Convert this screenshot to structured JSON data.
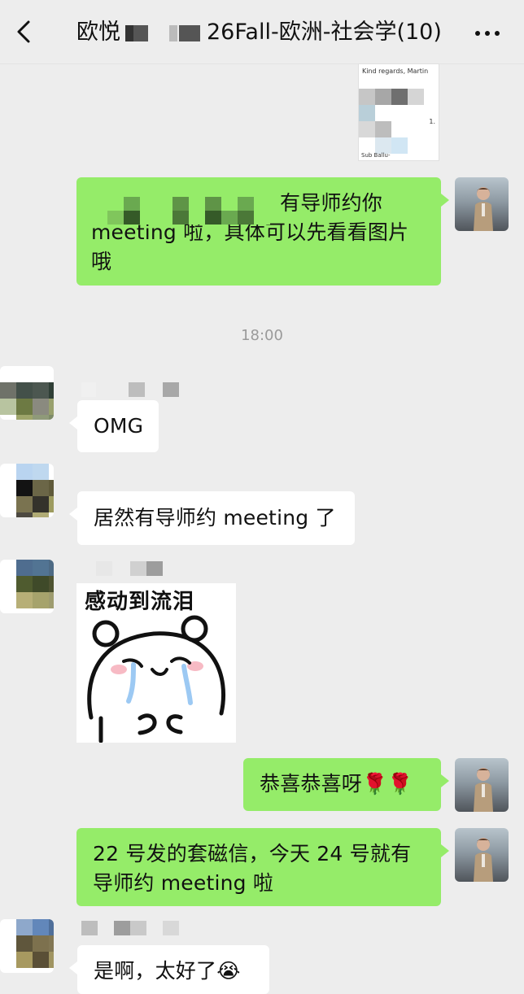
{
  "header": {
    "title_prefix": "欧悦",
    "title_suffix": "26Fall-欧洲-社会学(10)"
  },
  "thread": {
    "timestamp": "18:00",
    "messages": [
      {
        "id": "doc-preview",
        "side": "right",
        "type": "image",
        "text": "Kind regards, Martin",
        "page_marker": "1.",
        "footer_text": "Sub                Ballu-"
      },
      {
        "id": "m1",
        "side": "right",
        "type": "text",
        "line1_suffix": "有导师约你",
        "line2": "meeting 啦，具体可以先看看图片",
        "line3": "哦"
      },
      {
        "id": "m2",
        "side": "left",
        "type": "text",
        "text": "OMG"
      },
      {
        "id": "m3",
        "side": "left",
        "type": "text",
        "text": "居然有导师约 meeting 了"
      },
      {
        "id": "m4",
        "side": "left",
        "type": "sticker",
        "caption": "感动到流泪"
      },
      {
        "id": "m5",
        "side": "right",
        "type": "text",
        "text": "恭喜恭喜呀🌹🌹"
      },
      {
        "id": "m6",
        "side": "right",
        "type": "text",
        "line1": "22 号发的套磁信，今天 24 号就有",
        "line2": "导师约 meeting 啦"
      },
      {
        "id": "m7",
        "side": "left",
        "type": "text",
        "text": "是啊，太好了😭"
      }
    ]
  },
  "icons": {
    "back": "chevron-left-icon",
    "more": "more-dots-icon"
  },
  "colors": {
    "background": "#ededed",
    "outgoing_bubble": "#95ec69",
    "incoming_bubble": "#ffffff",
    "timestamp": "#9a9a9a"
  }
}
